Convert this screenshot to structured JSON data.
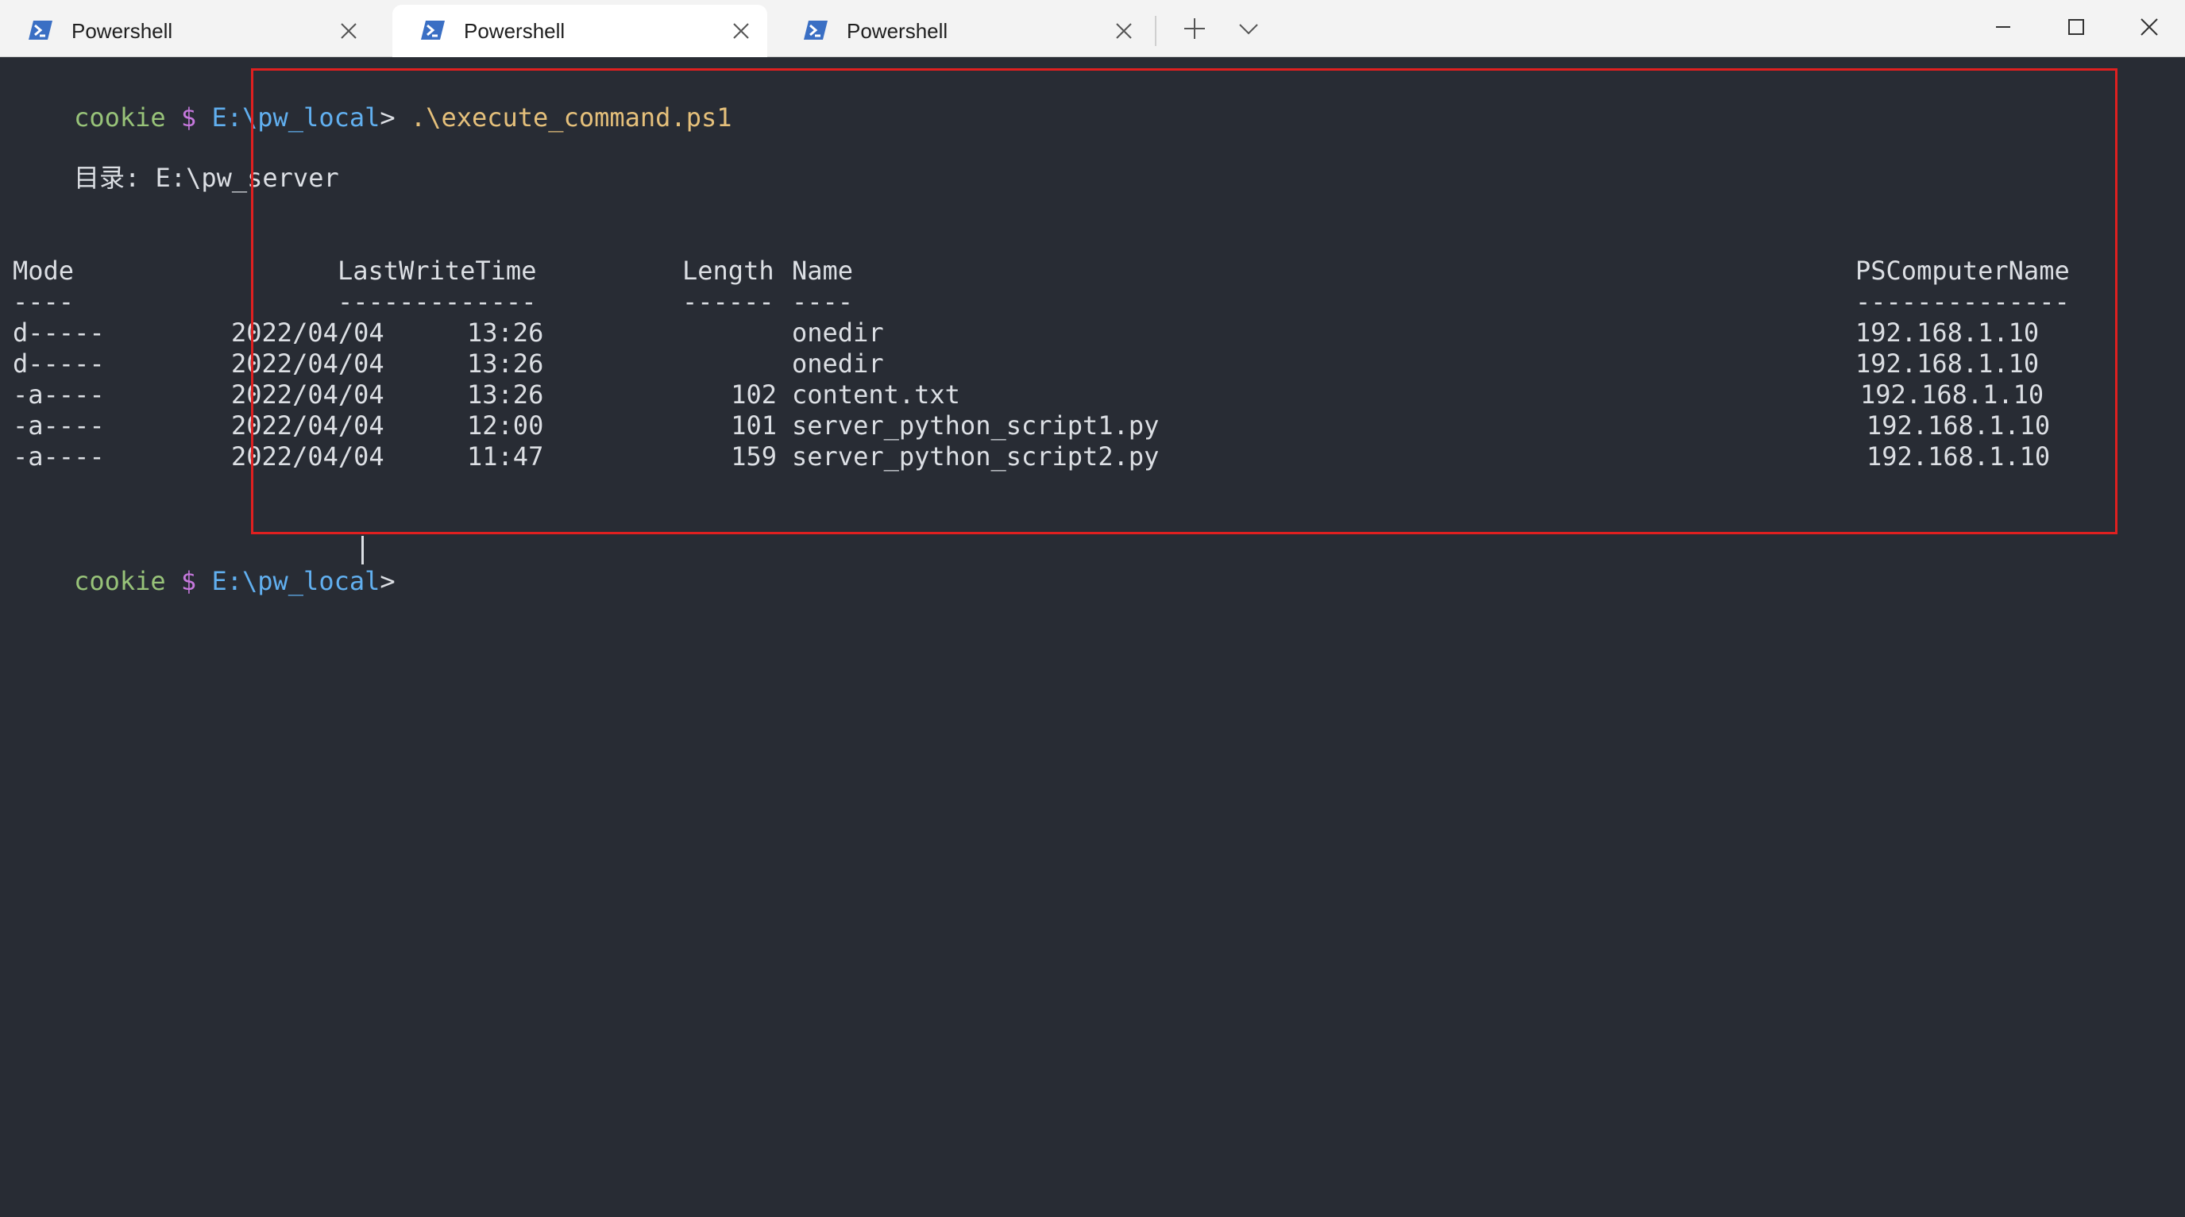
{
  "tabs": [
    {
      "label": "Powershell",
      "active": false
    },
    {
      "label": "Powershell",
      "active": true
    },
    {
      "label": "Powershell",
      "active": false
    }
  ],
  "toolbar": {
    "new_tab_icon": "plus-icon",
    "dropdown_icon": "chevron-down-icon"
  },
  "window_controls": {
    "minimize_icon": "minimize-icon",
    "maximize_icon": "maximize-icon",
    "close_icon": "close-icon"
  },
  "prompt": {
    "user": "cookie",
    "dollar": "$",
    "path": "E:\\pw_local",
    "arrow": ">"
  },
  "command": ".\\execute_command.ps1",
  "directory_line": "目录: E:\\pw_server",
  "table": {
    "headers": {
      "mode": "Mode",
      "lastwritetime": "LastWriteTime",
      "length": "Length",
      "name": "Name",
      "pscomputername": "PSComputerName"
    },
    "underlines": {
      "mode": "----",
      "lastwritetime": "-------------",
      "length": "------",
      "name": "----",
      "pscomputername": "--------------"
    },
    "rows": [
      {
        "mode": "d-----",
        "date": "2022/04/04",
        "time": "13:26",
        "length": "",
        "name": "onedir",
        "computer": "192.168.1.10"
      },
      {
        "mode": "d-----",
        "date": "2022/04/04",
        "time": "13:26",
        "length": "",
        "name": "onedir",
        "computer": "192.168.1.10"
      },
      {
        "mode": "-a----",
        "date": "2022/04/04",
        "time": "13:26",
        "length": "102",
        "name": "content.txt",
        "computer": "192.168.1.10"
      },
      {
        "mode": "-a----",
        "date": "2022/04/04",
        "time": "12:00",
        "length": "101",
        "name": "server_python_script1.py",
        "computer": "192.168.1.10"
      },
      {
        "mode": "-a----",
        "date": "2022/04/04",
        "time": "11:47",
        "length": "159",
        "name": "server_python_script2.py",
        "computer": "192.168.1.10"
      }
    ]
  },
  "colors": {
    "terminal_bg": "#282c34",
    "highlight_border": "#e02020",
    "prompt_user": "#98c379",
    "prompt_dollar": "#c678dd",
    "prompt_path": "#61afef",
    "command": "#e5c07b"
  }
}
